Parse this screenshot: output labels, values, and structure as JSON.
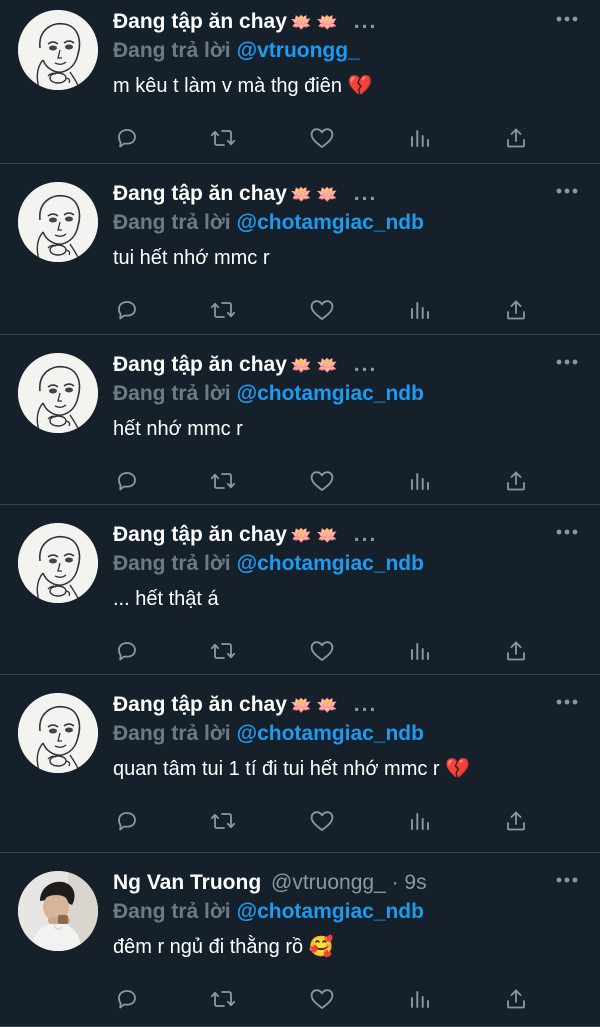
{
  "tweets": [
    {
      "name": "Đang tập ăn chay",
      "emoji": "🪷 🪷",
      "handle": "",
      "dots": "...",
      "reply_label": "Đang trả lời",
      "reply_to": "@vtruongg_",
      "text": "m kêu t làm v mà thg điên 💔",
      "avatar": "sketch"
    },
    {
      "name": "Đang tập ăn chay",
      "emoji": "🪷 🪷",
      "handle": "",
      "dots": "...",
      "reply_label": "Đang trả lời",
      "reply_to": "@chotamgiac_ndb",
      "text": "tui hết nhớ mmc r",
      "avatar": "sketch"
    },
    {
      "name": "Đang tập ăn chay",
      "emoji": "🪷 🪷",
      "handle": "",
      "dots": "...",
      "reply_label": "Đang trả lời",
      "reply_to": "@chotamgiac_ndb",
      "text": "hết nhớ mmc r",
      "avatar": "sketch"
    },
    {
      "name": "Đang tập ăn chay",
      "emoji": "🪷 🪷",
      "handle": "",
      "dots": "...",
      "reply_label": "Đang trả lời",
      "reply_to": "@chotamgiac_ndb",
      "text": "... hết thật á",
      "avatar": "sketch"
    },
    {
      "name": "Đang tập ăn chay",
      "emoji": "🪷 🪷",
      "handle": "",
      "dots": "...",
      "reply_label": "Đang trả lời",
      "reply_to": "@chotamgiac_ndb",
      "text": "quan tâm tui 1 tí đi tui hết nhớ mmc r 💔",
      "avatar": "sketch"
    },
    {
      "name": "Ng Van Truong",
      "emoji": "",
      "handle": "@vtruongg_ · 9s",
      "dots": "",
      "reply_label": "Đang trả lời",
      "reply_to": "@chotamgiac_ndb",
      "text": "đêm r ngủ đi thằng rồ 🥰",
      "avatar": "photo"
    }
  ],
  "action_icons": [
    "reply-icon",
    "retweet-icon",
    "like-icon",
    "views-icon",
    "share-icon"
  ],
  "colors": {
    "background": "#15202b",
    "divider": "#38444d",
    "link": "#1d9bf0",
    "muted": "#8b98a5"
  }
}
